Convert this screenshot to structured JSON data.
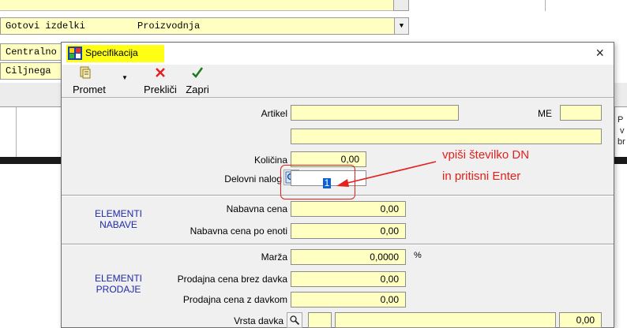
{
  "background": {
    "row1_label": "Gotovi izdelki",
    "row1_value": "Proizvodnja",
    "row2_label": "Centralno",
    "row3_label": "Ciljnega",
    "right_col_text": [
      "P",
      "v",
      "br"
    ]
  },
  "dialog": {
    "title": "Specifikacija",
    "close_glyph": "×",
    "toolbar": {
      "promet_label": "Promet",
      "preklici_label": "Prekliči",
      "zapri_label": "Zapri"
    },
    "fields": {
      "artikel_label": "Artikel",
      "me_label": "ME",
      "kolicina_label": "Količina",
      "kolicina_value": "0,00",
      "delovni_nalog_label": "Delovni nalog",
      "delovni_nalog_value": "1",
      "nabavna_cena_label": "Nabavna cena",
      "nabavna_cena_value": "0,00",
      "nabavna_cena_enoti_label": "Nabavna cena po enoti",
      "nabavna_cena_enoti_value": "0,00",
      "marza_label": "Marža",
      "marza_value": "0,0000",
      "marza_unit": "%",
      "prodajna_brez_label": "Prodajna cena brez davka",
      "prodajna_brez_value": "0,00",
      "prodajna_z_label": "Prodajna cena z davkom",
      "prodajna_z_value": "0,00",
      "vrsta_davka_label": "Vrsta davka",
      "vrsta_davka_value": "0,00"
    },
    "sections": {
      "nabave_line1": "ELEMENTI",
      "nabave_line2": "NABAVE",
      "prodaje_line1": "ELEMENTI",
      "prodaje_line2": "PRODAJE"
    }
  },
  "annotation": {
    "line1": "vpiši številko DN",
    "line2": "in pritisni Enter",
    "color": "#e3201b"
  },
  "colors": {
    "field_bg": "#ffffc2",
    "title_highlight": "#ffff14",
    "section_text": "#1f2aa8"
  }
}
